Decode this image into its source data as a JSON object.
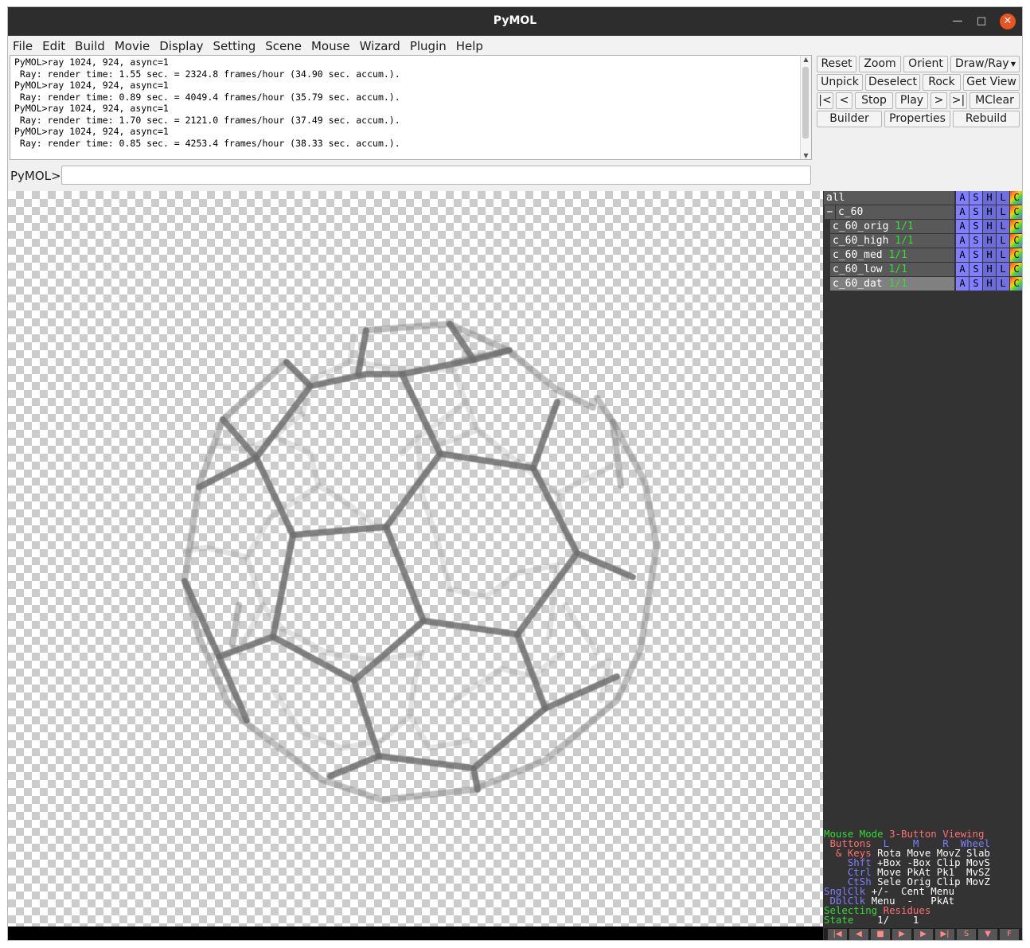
{
  "window": {
    "title": "PyMOL"
  },
  "menu": [
    "File",
    "Edit",
    "Build",
    "Movie",
    "Display",
    "Setting",
    "Scene",
    "Mouse",
    "Wizard",
    "Plugin",
    "Help"
  ],
  "console": {
    "lines": [
      "PyMOL>ray 1024, 924, async=1",
      " Ray: render time: 1.55 sec. = 2324.8 frames/hour (34.90 sec. accum.).",
      "PyMOL>ray 1024, 924, async=1",
      " Ray: render time: 0.89 sec. = 4049.4 frames/hour (35.79 sec. accum.).",
      "PyMOL>ray 1024, 924, async=1",
      " Ray: render time: 1.70 sec. = 2121.0 frames/hour (37.49 sec. accum.).",
      "PyMOL>ray 1024, 924, async=1",
      " Ray: render time: 0.85 sec. = 4253.4 frames/hour (38.33 sec. accum.)."
    ]
  },
  "command": {
    "label": "PyMOL>",
    "value": ""
  },
  "buttons": {
    "reset": "Reset",
    "zoom": "Zoom",
    "orient": "Orient",
    "draw_ray": "Draw/Ray",
    "unpick": "Unpick",
    "deselect": "Deselect",
    "rock": "Rock",
    "get_view": "Get View",
    "first": "|<",
    "prev": "<",
    "stop": "Stop",
    "play": "Play",
    "next": ">",
    "last": ">|",
    "mclear": "MClear",
    "builder": "Builder",
    "properties": "Properties",
    "rebuild": "Rebuild"
  },
  "objects": [
    {
      "name": "all",
      "state": ""
    },
    {
      "name": "c_60",
      "state": "",
      "collapse": "−"
    },
    {
      "name": "c_60_orig",
      "state": "1/1"
    },
    {
      "name": "c_60_high",
      "state": "1/1"
    },
    {
      "name": "c_60_med",
      "state": "1/1"
    },
    {
      "name": "c_60_low",
      "state": "1/1"
    },
    {
      "name": "c_60_dat",
      "state": "1/1"
    }
  ],
  "ashlc": [
    "A",
    "S",
    "H",
    "L",
    "C"
  ],
  "mouse_info": {
    "mode_label": "Mouse Mode",
    "mode_value": "3-Button Viewing",
    "buttons_label": "Buttons",
    "col_l": "L",
    "col_m": "M",
    "col_r": "R",
    "col_wheel": "Wheel",
    "keys_label": "& Keys",
    "row_none": "Rota Move MovZ Slab",
    "shft_label": "Shft",
    "row_shft": "+Box -Box Clip MovS",
    "ctrl_label": "Ctrl",
    "row_ctrl": "Move PkAt Pk1  MvSZ",
    "ctsh_label": "CtSh",
    "row_ctsh": "Sele Orig Clip MovZ",
    "snglclk_label": "SnglClk",
    "row_snglclk": "+/-  Cent Menu",
    "dblclk_label": "DblClk",
    "row_dblclk": "Menu  -   PkAt",
    "selecting_label": "Selecting",
    "selecting_value": "Residues",
    "state_label": "State",
    "state_value": "1/    1"
  },
  "transport_icons": [
    "rewind-icon",
    "step-back-icon",
    "stop-icon",
    "play-icon",
    "step-forward-icon",
    "fast-forward-icon",
    "scene-icon",
    "triangle-down-icon",
    "full-screen-icon"
  ],
  "transport_labels": [
    "|◀",
    "◀",
    "■",
    "▶",
    "▶",
    "▶|",
    "S",
    "▼",
    "F"
  ],
  "colors": {
    "panel_bg": "#333333",
    "console_bg": "#ffffff",
    "title_bg": "#2d2d2d",
    "close_btn": "#e95420"
  }
}
